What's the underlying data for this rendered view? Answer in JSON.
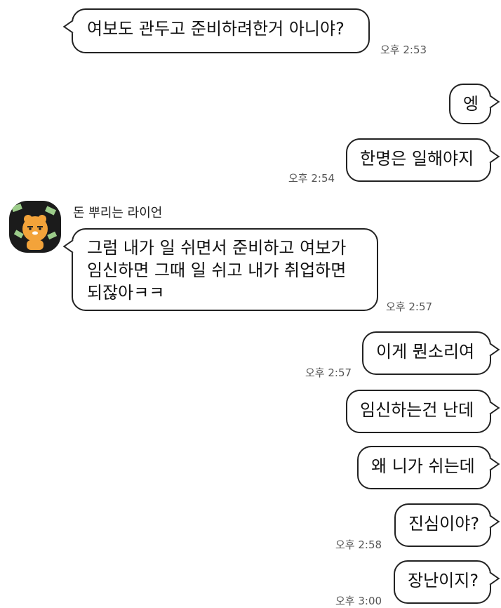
{
  "chat": {
    "messages": [
      {
        "text": "여보도 관두고 준비하려한거 아니야?",
        "time": "오후 2:53"
      },
      {
        "text": "엥"
      },
      {
        "text": "한명은 일해야지",
        "time": "오후 2:54"
      },
      {
        "sender": "돈 뿌리는 라이언",
        "lines": [
          "그럼 내가 일 쉬면서 준비하고 여보가",
          "임신하면 그때 일 쉬고 내가 취업하면",
          "되잖아ㅋㅋ"
        ],
        "time": "오후 2:57"
      },
      {
        "text": "이게 뭔소리여",
        "time": "오후 2:57"
      },
      {
        "text": "임신하는건 난데"
      },
      {
        "text": "왜 니가 쉬는데"
      },
      {
        "text": "진심이야?",
        "time": "오후 2:58"
      },
      {
        "text": "장난이지?",
        "time": "오후 3:00"
      }
    ]
  },
  "avatar": {
    "icon": "ryan-character-icon",
    "bg": "#1b1b1b",
    "face": "#f3a33a",
    "money": "#9ccc8a"
  }
}
